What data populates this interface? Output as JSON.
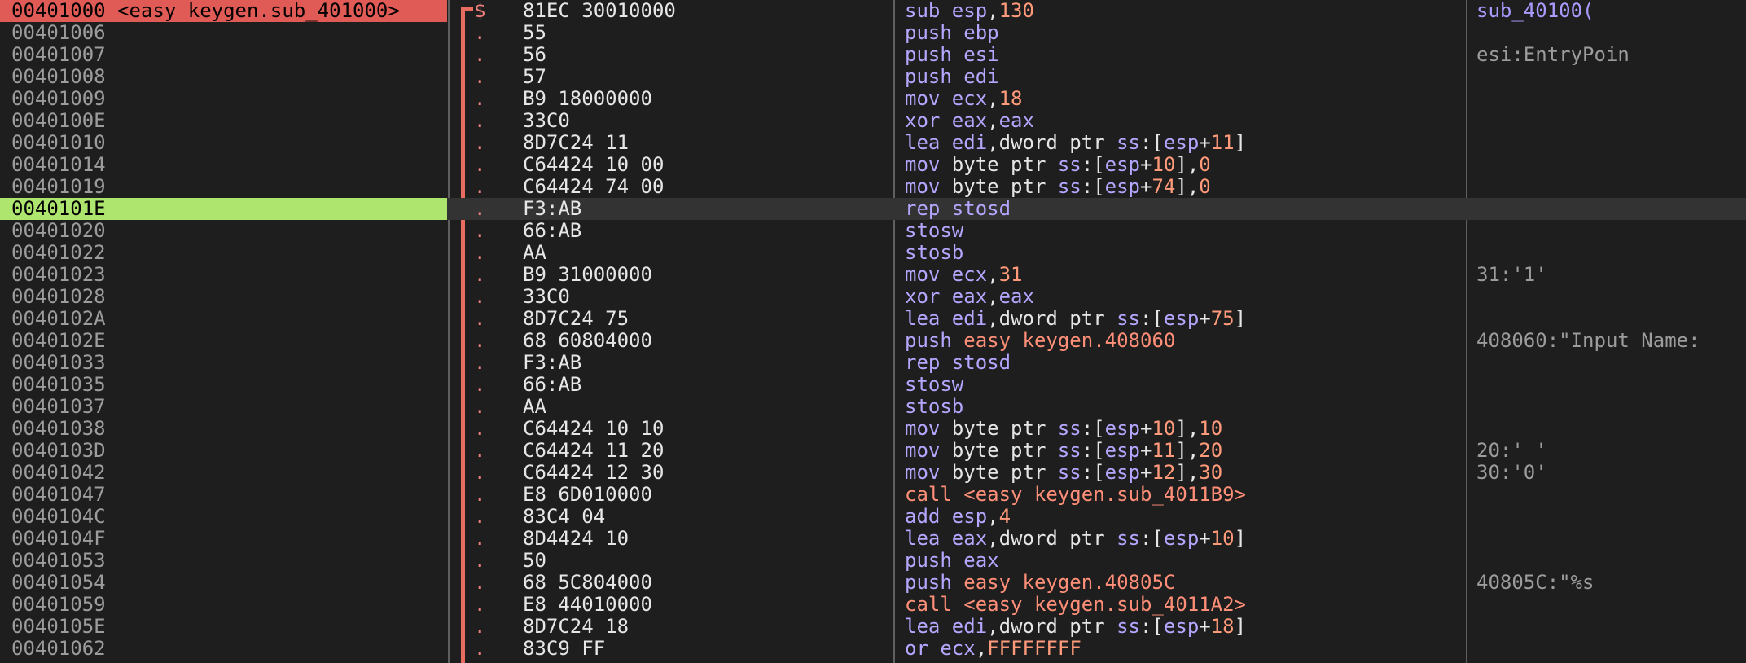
{
  "rows": [
    {
      "addr": "00401000 <easy keygen.sub_401000>",
      "flag": "$",
      "bytes": "81EC 30010000",
      "tokens": [
        {
          "t": "sub ",
          "c": "mn"
        },
        {
          "t": "esp",
          "c": "reg"
        },
        {
          "t": ",",
          "c": "txt"
        },
        {
          "t": "130",
          "c": "num"
        }
      ],
      "comment": "sub_40100(",
      "state": "eip"
    },
    {
      "addr": "00401006",
      "flag": ".",
      "bytes": "55",
      "tokens": [
        {
          "t": "push ",
          "c": "mn"
        },
        {
          "t": "ebp",
          "c": "reg"
        }
      ],
      "comment": ""
    },
    {
      "addr": "00401007",
      "flag": ".",
      "bytes": "56",
      "tokens": [
        {
          "t": "push ",
          "c": "mn"
        },
        {
          "t": "esi",
          "c": "reg"
        }
      ],
      "comment": "esi:EntryPoin"
    },
    {
      "addr": "00401008",
      "flag": ".",
      "bytes": "57",
      "tokens": [
        {
          "t": "push ",
          "c": "mn"
        },
        {
          "t": "edi",
          "c": "reg"
        }
      ],
      "comment": ""
    },
    {
      "addr": "00401009",
      "flag": ".",
      "bytes": "B9 18000000",
      "tokens": [
        {
          "t": "mov ",
          "c": "mn"
        },
        {
          "t": "ecx",
          "c": "reg"
        },
        {
          "t": ",",
          "c": "txt"
        },
        {
          "t": "18",
          "c": "num"
        }
      ],
      "comment": ""
    },
    {
      "addr": "0040100E",
      "flag": ".",
      "bytes": "33C0",
      "tokens": [
        {
          "t": "xor ",
          "c": "mn"
        },
        {
          "t": "eax",
          "c": "reg"
        },
        {
          "t": ",",
          "c": "txt"
        },
        {
          "t": "eax",
          "c": "reg"
        }
      ],
      "comment": ""
    },
    {
      "addr": "00401010",
      "flag": ".",
      "bytes": "8D7C24 11",
      "tokens": [
        {
          "t": "lea ",
          "c": "mn"
        },
        {
          "t": "edi",
          "c": "reg"
        },
        {
          "t": ",dword ptr ",
          "c": "txt"
        },
        {
          "t": "ss",
          "c": "seg"
        },
        {
          "t": ":[",
          "c": "brk"
        },
        {
          "t": "esp",
          "c": "reg"
        },
        {
          "t": "+",
          "c": "txt"
        },
        {
          "t": "11",
          "c": "num"
        },
        {
          "t": "]",
          "c": "brk"
        }
      ],
      "comment": ""
    },
    {
      "addr": "00401014",
      "flag": ".",
      "bytes": "C64424 10 00",
      "tokens": [
        {
          "t": "mov ",
          "c": "mn"
        },
        {
          "t": "byte ptr ",
          "c": "txt"
        },
        {
          "t": "ss",
          "c": "seg"
        },
        {
          "t": ":[",
          "c": "brk"
        },
        {
          "t": "esp",
          "c": "reg"
        },
        {
          "t": "+",
          "c": "txt"
        },
        {
          "t": "10",
          "c": "num"
        },
        {
          "t": "],",
          "c": "brk"
        },
        {
          "t": "0",
          "c": "num"
        }
      ],
      "comment": ""
    },
    {
      "addr": "00401019",
      "flag": ".",
      "bytes": "C64424 74 00",
      "tokens": [
        {
          "t": "mov ",
          "c": "mn"
        },
        {
          "t": "byte ptr ",
          "c": "txt"
        },
        {
          "t": "ss",
          "c": "seg"
        },
        {
          "t": ":[",
          "c": "brk"
        },
        {
          "t": "esp",
          "c": "reg"
        },
        {
          "t": "+",
          "c": "txt"
        },
        {
          "t": "74",
          "c": "num"
        },
        {
          "t": "],",
          "c": "brk"
        },
        {
          "t": "0",
          "c": "num"
        }
      ],
      "comment": ""
    },
    {
      "addr": "0040101E",
      "flag": ".",
      "bytes": "F3:AB",
      "tokens": [
        {
          "t": "rep stosd",
          "c": "mn"
        }
      ],
      "comment": "",
      "state": "cursor"
    },
    {
      "addr": "00401020",
      "flag": ".",
      "bytes": "66:AB",
      "tokens": [
        {
          "t": "stosw",
          "c": "mn"
        }
      ],
      "comment": ""
    },
    {
      "addr": "00401022",
      "flag": ".",
      "bytes": "AA",
      "tokens": [
        {
          "t": "stosb",
          "c": "mn"
        }
      ],
      "comment": ""
    },
    {
      "addr": "00401023",
      "flag": ".",
      "bytes": "B9 31000000",
      "tokens": [
        {
          "t": "mov ",
          "c": "mn"
        },
        {
          "t": "ecx",
          "c": "reg"
        },
        {
          "t": ",",
          "c": "txt"
        },
        {
          "t": "31",
          "c": "num"
        }
      ],
      "comment": "31:'1'"
    },
    {
      "addr": "00401028",
      "flag": ".",
      "bytes": "33C0",
      "tokens": [
        {
          "t": "xor ",
          "c": "mn"
        },
        {
          "t": "eax",
          "c": "reg"
        },
        {
          "t": ",",
          "c": "txt"
        },
        {
          "t": "eax",
          "c": "reg"
        }
      ],
      "comment": ""
    },
    {
      "addr": "0040102A",
      "flag": ".",
      "bytes": "8D7C24 75",
      "tokens": [
        {
          "t": "lea ",
          "c": "mn"
        },
        {
          "t": "edi",
          "c": "reg"
        },
        {
          "t": ",dword ptr ",
          "c": "txt"
        },
        {
          "t": "ss",
          "c": "seg"
        },
        {
          "t": ":[",
          "c": "brk"
        },
        {
          "t": "esp",
          "c": "reg"
        },
        {
          "t": "+",
          "c": "txt"
        },
        {
          "t": "75",
          "c": "num"
        },
        {
          "t": "]",
          "c": "brk"
        }
      ],
      "comment": ""
    },
    {
      "addr": "0040102E",
      "flag": ".",
      "bytes": "68 60804000",
      "tokens": [
        {
          "t": "push ",
          "c": "mn"
        },
        {
          "t": "easy keygen.408060",
          "c": "call"
        }
      ],
      "comment": "408060:\"Input Name:"
    },
    {
      "addr": "00401033",
      "flag": ".",
      "bytes": "F3:AB",
      "tokens": [
        {
          "t": "rep stosd",
          "c": "mn"
        }
      ],
      "comment": ""
    },
    {
      "addr": "00401035",
      "flag": ".",
      "bytes": "66:AB",
      "tokens": [
        {
          "t": "stosw",
          "c": "mn"
        }
      ],
      "comment": ""
    },
    {
      "addr": "00401037",
      "flag": ".",
      "bytes": "AA",
      "tokens": [
        {
          "t": "stosb",
          "c": "mn"
        }
      ],
      "comment": ""
    },
    {
      "addr": "00401038",
      "flag": ".",
      "bytes": "C64424 10 10",
      "tokens": [
        {
          "t": "mov ",
          "c": "mn"
        },
        {
          "t": "byte ptr ",
          "c": "txt"
        },
        {
          "t": "ss",
          "c": "seg"
        },
        {
          "t": ":[",
          "c": "brk"
        },
        {
          "t": "esp",
          "c": "reg"
        },
        {
          "t": "+",
          "c": "txt"
        },
        {
          "t": "10",
          "c": "num"
        },
        {
          "t": "],",
          "c": "brk"
        },
        {
          "t": "10",
          "c": "num"
        }
      ],
      "comment": ""
    },
    {
      "addr": "0040103D",
      "flag": ".",
      "bytes": "C64424 11 20",
      "tokens": [
        {
          "t": "mov ",
          "c": "mn"
        },
        {
          "t": "byte ptr ",
          "c": "txt"
        },
        {
          "t": "ss",
          "c": "seg"
        },
        {
          "t": ":[",
          "c": "brk"
        },
        {
          "t": "esp",
          "c": "reg"
        },
        {
          "t": "+",
          "c": "txt"
        },
        {
          "t": "11",
          "c": "num"
        },
        {
          "t": "],",
          "c": "brk"
        },
        {
          "t": "20",
          "c": "num"
        }
      ],
      "comment": "20:' '"
    },
    {
      "addr": "00401042",
      "flag": ".",
      "bytes": "C64424 12 30",
      "tokens": [
        {
          "t": "mov ",
          "c": "mn"
        },
        {
          "t": "byte ptr ",
          "c": "txt"
        },
        {
          "t": "ss",
          "c": "seg"
        },
        {
          "t": ":[",
          "c": "brk"
        },
        {
          "t": "esp",
          "c": "reg"
        },
        {
          "t": "+",
          "c": "txt"
        },
        {
          "t": "12",
          "c": "num"
        },
        {
          "t": "],",
          "c": "brk"
        },
        {
          "t": "30",
          "c": "num"
        }
      ],
      "comment": "30:'0'"
    },
    {
      "addr": "00401047",
      "flag": ".",
      "bytes": "E8 6D010000",
      "tokens": [
        {
          "t": "call <easy keygen.sub_4011B9>",
          "c": "call"
        }
      ],
      "comment": ""
    },
    {
      "addr": "0040104C",
      "flag": ".",
      "bytes": "83C4 04",
      "tokens": [
        {
          "t": "add ",
          "c": "mn"
        },
        {
          "t": "esp",
          "c": "reg"
        },
        {
          "t": ",",
          "c": "txt"
        },
        {
          "t": "4",
          "c": "num"
        }
      ],
      "comment": ""
    },
    {
      "addr": "0040104F",
      "flag": ".",
      "bytes": "8D4424 10",
      "tokens": [
        {
          "t": "lea ",
          "c": "mn"
        },
        {
          "t": "eax",
          "c": "reg"
        },
        {
          "t": ",dword ptr ",
          "c": "txt"
        },
        {
          "t": "ss",
          "c": "seg"
        },
        {
          "t": ":[",
          "c": "brk"
        },
        {
          "t": "esp",
          "c": "reg"
        },
        {
          "t": "+",
          "c": "txt"
        },
        {
          "t": "10",
          "c": "num"
        },
        {
          "t": "]",
          "c": "brk"
        }
      ],
      "comment": ""
    },
    {
      "addr": "00401053",
      "flag": ".",
      "bytes": "50",
      "tokens": [
        {
          "t": "push ",
          "c": "mn"
        },
        {
          "t": "eax",
          "c": "reg"
        }
      ],
      "comment": ""
    },
    {
      "addr": "00401054",
      "flag": ".",
      "bytes": "68 5C804000",
      "tokens": [
        {
          "t": "push ",
          "c": "mn"
        },
        {
          "t": "easy keygen.40805C",
          "c": "call"
        }
      ],
      "comment": "40805C:\"%s"
    },
    {
      "addr": "00401059",
      "flag": ".",
      "bytes": "E8 44010000",
      "tokens": [
        {
          "t": "call <easy keygen.sub_4011A2>",
          "c": "call"
        }
      ],
      "comment": ""
    },
    {
      "addr": "0040105E",
      "flag": ".",
      "bytes": "8D7C24 18",
      "tokens": [
        {
          "t": "lea ",
          "c": "mn"
        },
        {
          "t": "edi",
          "c": "reg"
        },
        {
          "t": ",dword ptr ",
          "c": "txt"
        },
        {
          "t": "ss",
          "c": "seg"
        },
        {
          "t": ":[",
          "c": "brk"
        },
        {
          "t": "esp",
          "c": "reg"
        },
        {
          "t": "+",
          "c": "txt"
        },
        {
          "t": "18",
          "c": "num"
        },
        {
          "t": "]",
          "c": "brk"
        }
      ],
      "comment": ""
    },
    {
      "addr": "00401062",
      "flag": ".",
      "bytes": "83C9 FF",
      "tokens": [
        {
          "t": "or ",
          "c": "mn"
        },
        {
          "t": "ecx",
          "c": "reg"
        },
        {
          "t": ",",
          "c": "txt"
        },
        {
          "t": "FFFFFFFF",
          "c": "num"
        }
      ],
      "comment": ""
    }
  ],
  "colors": {
    "background": "#1e1e1e",
    "eip_highlight": "#e05b55",
    "cursor_highlight": "#aee56f",
    "jump_bracket": "#e86c5f",
    "mnemonic": "#b4a7ff",
    "number": "#ff9a7a",
    "call_target": "#ff8f78"
  }
}
